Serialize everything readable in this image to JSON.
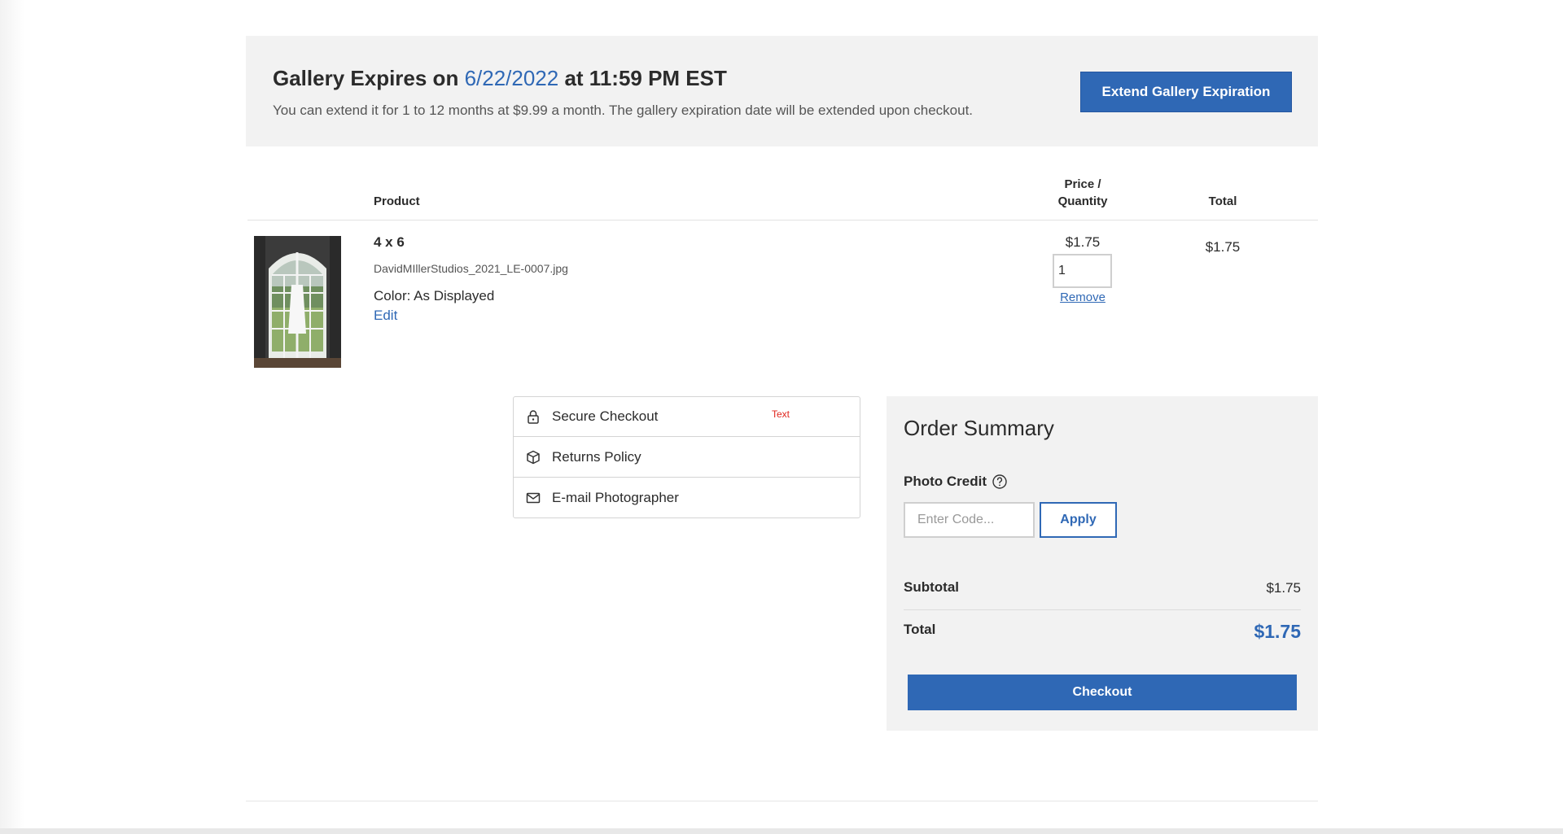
{
  "banner": {
    "title_prefix": "Gallery Expires on ",
    "date": "6/22/2022",
    "title_suffix": " at 11:59 PM EST",
    "subtitle": "You can extend it for 1 to 12 months at $9.99 a month. The gallery expiration date will be extended upon checkout.",
    "extend_button": "Extend Gallery Expiration"
  },
  "cart": {
    "headers": {
      "product": "Product",
      "price_line1": "Price /",
      "price_line2": "Quantity",
      "total": "Total"
    },
    "items": [
      {
        "name": "4 x 6",
        "filename": "DavidMIllerStudios_2021_LE-0007.jpg",
        "option": "Color: As Displayed",
        "edit_label": "Edit",
        "unit_price": "$1.75",
        "quantity": "1",
        "remove_label": "Remove",
        "line_total": "$1.75"
      }
    ]
  },
  "info_links": [
    {
      "label": "Secure Checkout",
      "icon": "lock-icon",
      "tag": "Text"
    },
    {
      "label": "Returns Policy",
      "icon": "box-icon"
    },
    {
      "label": "E-mail Photographer",
      "icon": "mail-icon"
    }
  ],
  "summary": {
    "title": "Order Summary",
    "photo_credit_label": "Photo Credit",
    "help_icon": "question-circle-icon",
    "code_placeholder": "Enter Code...",
    "apply_label": "Apply",
    "subtotal_label": "Subtotal",
    "subtotal_value": "$1.75",
    "total_label": "Total",
    "total_value": "$1.75",
    "checkout_label": "Checkout"
  },
  "colors": {
    "accent": "#2f68b5",
    "panel_bg": "#f2f2f2",
    "tag_red": "#e0261d"
  }
}
